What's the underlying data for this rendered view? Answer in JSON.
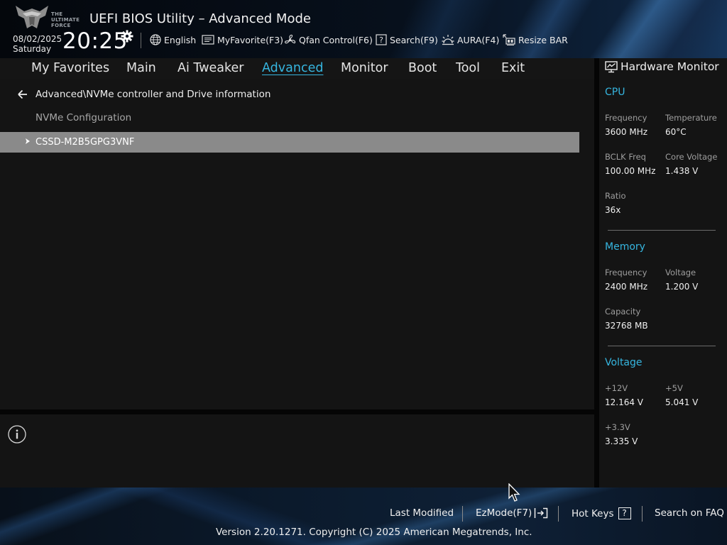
{
  "header": {
    "logo_text": [
      "THE",
      "ULTIMATE",
      "FORCE"
    ],
    "title": "UEFI BIOS Utility – Advanced Mode",
    "date": "08/02/2025",
    "day": "Saturday",
    "time": "20:25",
    "tools": [
      {
        "label": "English",
        "icon": "globe-icon"
      },
      {
        "label": "MyFavorite(F3)",
        "icon": "favorite-icon"
      },
      {
        "label": "Qfan Control(F6)",
        "icon": "fan-icon"
      },
      {
        "label": "Search(F9)",
        "icon": "search-help-icon"
      },
      {
        "label": "AURA(F4)",
        "icon": "aura-icon"
      },
      {
        "label": "Resize BAR",
        "icon": "resize-bar-icon"
      }
    ]
  },
  "menu": {
    "tabs": [
      "My Favorites",
      "Main",
      "Ai Tweaker",
      "Advanced",
      "Monitor",
      "Boot",
      "Tool",
      "Exit"
    ],
    "active": "Advanced"
  },
  "content": {
    "breadcrumb": "Advanced\\NVMe controller and Drive information",
    "section_label": "NVMe Configuration",
    "items": [
      {
        "label": "CSSD-M2B5GPG3VNF",
        "selected": true
      }
    ]
  },
  "hardware_monitor": {
    "title": "Hardware Monitor",
    "cpu": {
      "title": "CPU",
      "frequency_label": "Frequency",
      "frequency": "3600 MHz",
      "temperature_label": "Temperature",
      "temperature": "60°C",
      "bclk_label": "BCLK Freq",
      "bclk": "100.00 MHz",
      "core_voltage_label": "Core Voltage",
      "core_voltage": "1.438 V",
      "ratio_label": "Ratio",
      "ratio": "36x"
    },
    "memory": {
      "title": "Memory",
      "frequency_label": "Frequency",
      "frequency": "2400 MHz",
      "voltage_label": "Voltage",
      "voltage": "1.200 V",
      "capacity_label": "Capacity",
      "capacity": "32768 MB"
    },
    "voltage": {
      "title": "Voltage",
      "v12_label": "+12V",
      "v12": "12.164 V",
      "v5_label": "+5V",
      "v5": "5.041 V",
      "v33_label": "+3.3V",
      "v33": "3.335 V"
    }
  },
  "footer": {
    "last_modified": "Last Modified",
    "ezmode": "EzMode(F7)",
    "hot_keys": "Hot Keys",
    "hot_keys_glyph": "?",
    "search_faq": "Search on FAQ",
    "version": "Version 2.20.1271. Copyright (C) 2025 American Megatrends, Inc."
  },
  "colors": {
    "accent": "#36b6e0",
    "selected_row": "#8a8a8a",
    "panel": "#141414"
  }
}
